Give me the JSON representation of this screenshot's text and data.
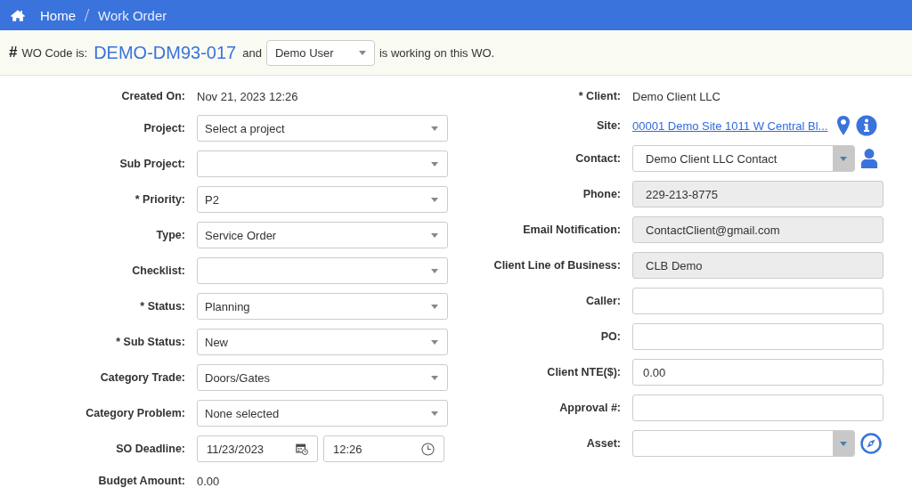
{
  "breadcrumb": [
    {
      "label": "Home"
    },
    {
      "label": "Work Order"
    }
  ],
  "wo_bar": {
    "hash": "#",
    "prefix": "WO Code is:",
    "code": "DEMO-DM93-017",
    "and": "and",
    "user": "Demo User",
    "suffix": "is working on this WO."
  },
  "left_fields": [
    {
      "label": "Created On:",
      "kind": "text",
      "value": "Nov 21, 2023 12:26"
    },
    {
      "label": "Project:",
      "kind": "select",
      "value": "Select a project"
    },
    {
      "label": "Sub Project:",
      "kind": "select"
    },
    {
      "label": "* Priority:",
      "kind": "select",
      "value": "P2"
    },
    {
      "label": "Type:",
      "kind": "select",
      "value": "Service Order"
    },
    {
      "label": "Checklist:",
      "kind": "select"
    },
    {
      "label": "* Status:",
      "kind": "select",
      "value": "Planning"
    },
    {
      "label": "* Sub Status:",
      "kind": "select",
      "value": "New"
    },
    {
      "label": "Category Trade:",
      "kind": "select",
      "value": "Doors/Gates"
    },
    {
      "label": "Category Problem:",
      "kind": "select",
      "value": "None selected"
    },
    {
      "label": "SO Deadline:",
      "kind": "datetime",
      "date": "11/23/2023",
      "time": "12:26"
    },
    {
      "label": "Budget Amount:",
      "kind": "text",
      "value": "0.00"
    }
  ],
  "right_fields": [
    {
      "label": "* Client:",
      "kind": "text",
      "value": "Demo Client LLC"
    },
    {
      "label": "Site:",
      "kind": "link",
      "value": "00001 Demo Site 1011 W Central Bl..."
    },
    {
      "label": "Contact:",
      "kind": "combo",
      "value": "Demo Client LLC Contact"
    },
    {
      "label": "Phone:",
      "kind": "readonly",
      "value": "229-213-8775"
    },
    {
      "label": "Email Notification:",
      "kind": "readonly",
      "value": "ContactClient@gmail.com"
    },
    {
      "label": "Client Line of Business:",
      "kind": "readonly",
      "value": "CLB Demo"
    },
    {
      "label": "Caller:",
      "kind": "input"
    },
    {
      "label": "PO:",
      "kind": "input"
    },
    {
      "label": "Client NTE($):",
      "kind": "input",
      "value": "0.00"
    },
    {
      "label": "Approval #:",
      "kind": "input"
    },
    {
      "label": "Asset:",
      "kind": "combo"
    }
  ]
}
